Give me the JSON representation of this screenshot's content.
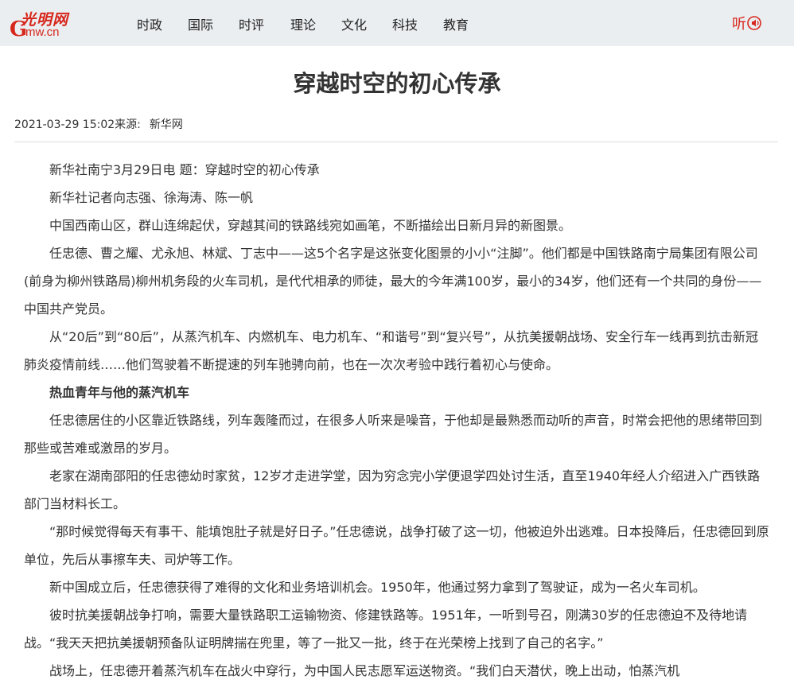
{
  "brand": {
    "logo_cn": "光明网",
    "logo_g": "G",
    "logo_en": "mw.cn",
    "accent": "#d7261b",
    "topbar_bg": "#ebeef1"
  },
  "nav": [
    "时政",
    "国际",
    "时评",
    "理论",
    "文化",
    "科技",
    "教育"
  ],
  "listen_label": "听",
  "article": {
    "title": "穿越时空的初心传承",
    "datetime": "2021-03-29 15:02",
    "source_label": "来源:",
    "source": "新华网",
    "paragraphs": [
      "新华社南宁3月29日电 题：穿越时空的初心传承",
      "新华社记者向志强、徐海涛、陈一帆",
      "中国西南山区，群山连绵起伏，穿越其间的铁路线宛如画笔，不断描绘出日新月异的新图景。",
      "任忠德、曹之耀、尤永旭、林斌、丁志中——这5个名字是这张变化图景的小小“注脚”。他们都是中国铁路南宁局集团有限公司(前身为柳州铁路局)柳州机务段的火车司机，是代代相承的师徒，最大的今年满100岁，最小的34岁，他们还有一个共同的身份——中国共产党员。",
      "从“20后”到“80后”，从蒸汽机车、内燃机车、电力机车、“和谐号”到“复兴号”，从抗美援朝战场、安全行车一线再到抗击新冠肺炎疫情前线……他们驾驶着不断提速的列车驰骋向前，也在一次次考验中践行着初心与使命。",
      "热血青年与他的蒸汽机车",
      "任忠德居住的小区靠近铁路线，列车轰隆而过，在很多人听来是噪音，于他却是最熟悉而动听的声音，时常会把他的思绪带回到那些或苦难或激昂的岁月。",
      "老家在湖南邵阳的任忠德幼时家贫，12岁才走进学堂，因为穷念完小学便退学四处讨生活，直至1940年经人介绍进入广西铁路部门当材料长工。",
      "“那时候觉得每天有事干、能填饱肚子就是好日子。”任忠德说，战争打破了这一切，他被迫外出逃难。日本投降后，任忠德回到原单位，先后从事擦车夫、司炉等工作。",
      "新中国成立后，任忠德获得了难得的文化和业务培训机会。1950年，他通过努力拿到了驾驶证，成为一名火车司机。",
      "彼时抗美援朝战争打响，需要大量铁路职工运输物资、修建铁路等。1951年，一听到号召，刚满30岁的任忠德迫不及待地请战。“我天天把抗美援朝预备队证明牌揣在兜里，等了一批又一批，终于在光荣榜上找到了自己的名字。”",
      "战场上，任忠德开着蒸汽机车在战火中穿行，为中国人民志愿军运送物资。“我们白天潜伏，晚上出动，怕蒸汽机"
    ]
  }
}
